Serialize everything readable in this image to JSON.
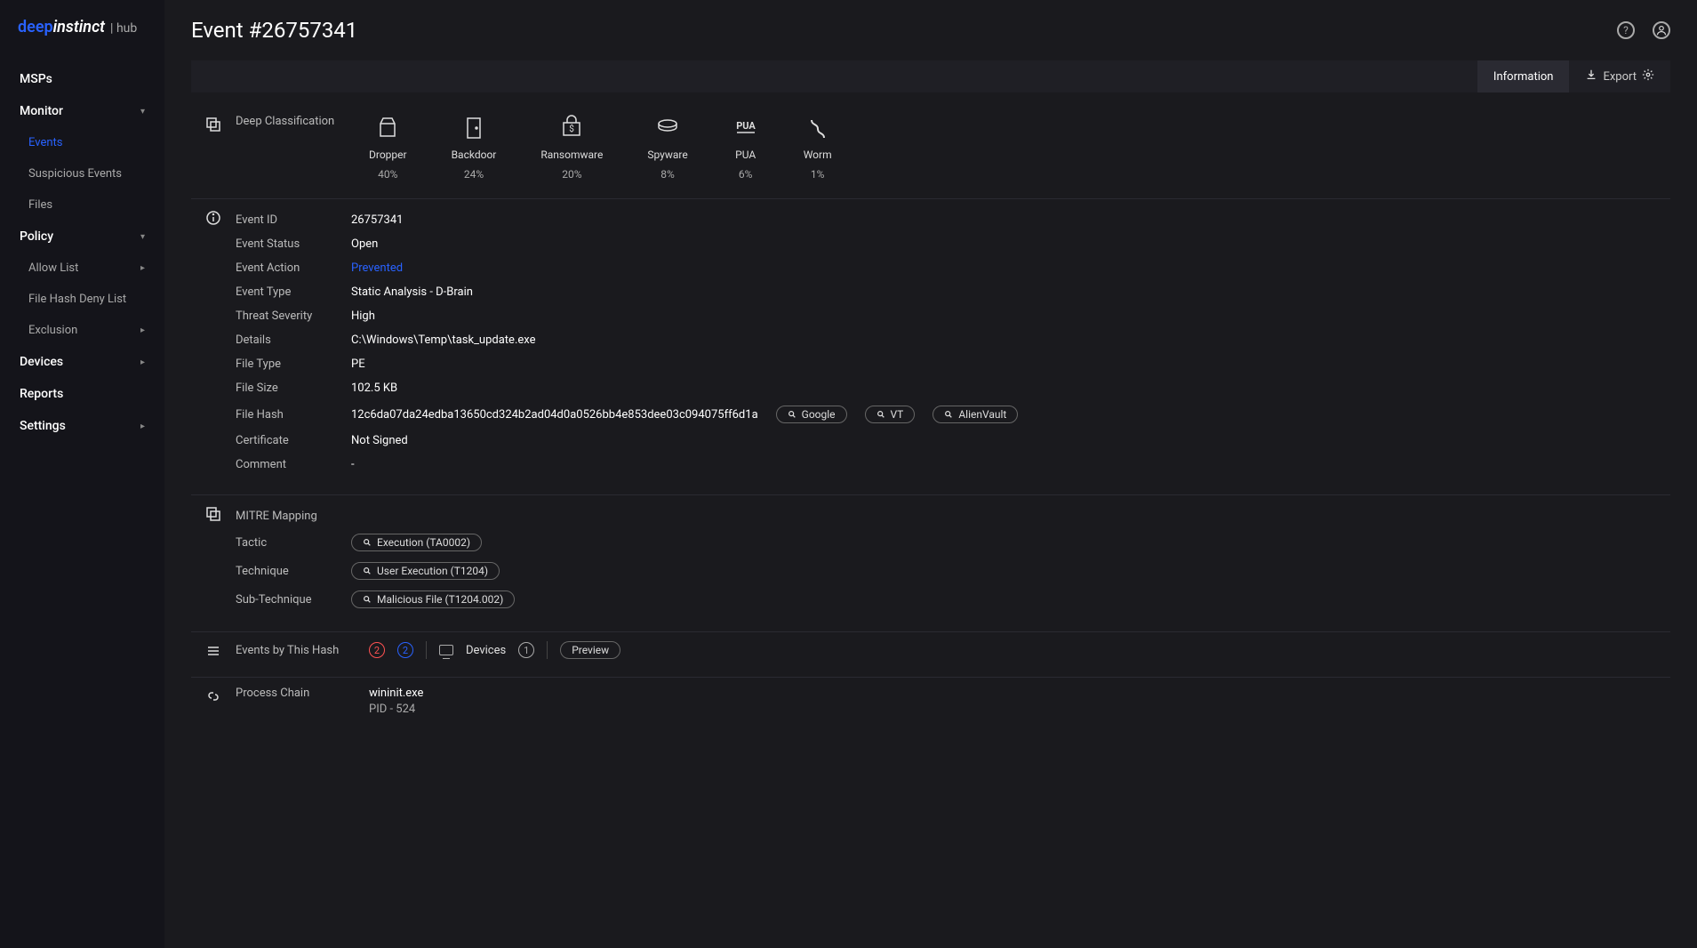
{
  "brand": {
    "deep": "deep",
    "instinct": "instinct",
    "hub": "| hub"
  },
  "nav": {
    "msps": "MSPs",
    "monitor": {
      "title": "Monitor",
      "events": "Events",
      "suspicious": "Suspicious Events",
      "files": "Files"
    },
    "policy": {
      "title": "Policy",
      "allow": "Allow List",
      "denyhash": "File Hash Deny List",
      "exclusion": "Exclusion"
    },
    "devices": "Devices",
    "reports": "Reports",
    "settings": "Settings"
  },
  "header": {
    "title": "Event #26757341",
    "tab_info": "Information",
    "export": "Export"
  },
  "classification": {
    "label": "Deep Classification",
    "items": [
      {
        "name": "Dropper",
        "pct": "40%"
      },
      {
        "name": "Backdoor",
        "pct": "24%"
      },
      {
        "name": "Ransomware",
        "pct": "20%"
      },
      {
        "name": "Spyware",
        "pct": "8%"
      },
      {
        "name": "PUA",
        "pct": "6%"
      },
      {
        "name": "Worm",
        "pct": "1%"
      }
    ]
  },
  "details": {
    "event_id": {
      "label": "Event ID",
      "value": "26757341"
    },
    "event_status": {
      "label": "Event Status",
      "value": "Open"
    },
    "event_action": {
      "label": "Event Action",
      "value": "Prevented"
    },
    "event_type": {
      "label": "Event Type",
      "value": "Static Analysis - D-Brain"
    },
    "threat_severity": {
      "label": "Threat Severity",
      "value": "High"
    },
    "details_row": {
      "label": "Details",
      "value": "C:\\Windows\\Temp\\task_update.exe"
    },
    "file_type": {
      "label": "File Type",
      "value": "PE"
    },
    "file_size": {
      "label": "File Size",
      "value": "102.5 KB"
    },
    "file_hash": {
      "label": "File Hash",
      "value": "12c6da07da24edba13650cd324b2ad04d0a0526bb4e853dee03c094075ff6d1a",
      "pills": {
        "google": "Google",
        "vt": "VT",
        "av": "AlienVault"
      }
    },
    "certificate": {
      "label": "Certificate",
      "value": "Not Signed"
    },
    "comment": {
      "label": "Comment",
      "value": "-"
    }
  },
  "mitre": {
    "label": "MITRE Mapping",
    "tactic": {
      "label": "Tactic",
      "value": "Execution (TA0002)"
    },
    "technique": {
      "label": "Technique",
      "value": "User Execution (T1204)"
    },
    "subtech": {
      "label": "Sub-Technique",
      "value": "Malicious File (T1204.002)"
    }
  },
  "events_by_hash": {
    "label": "Events by This Hash",
    "red": "2",
    "blue": "2",
    "devices": "Devices",
    "devcount": "1",
    "preview": "Preview"
  },
  "process_chain": {
    "label": "Process Chain",
    "proc": "wininit.exe",
    "pid": "PID - 524"
  }
}
